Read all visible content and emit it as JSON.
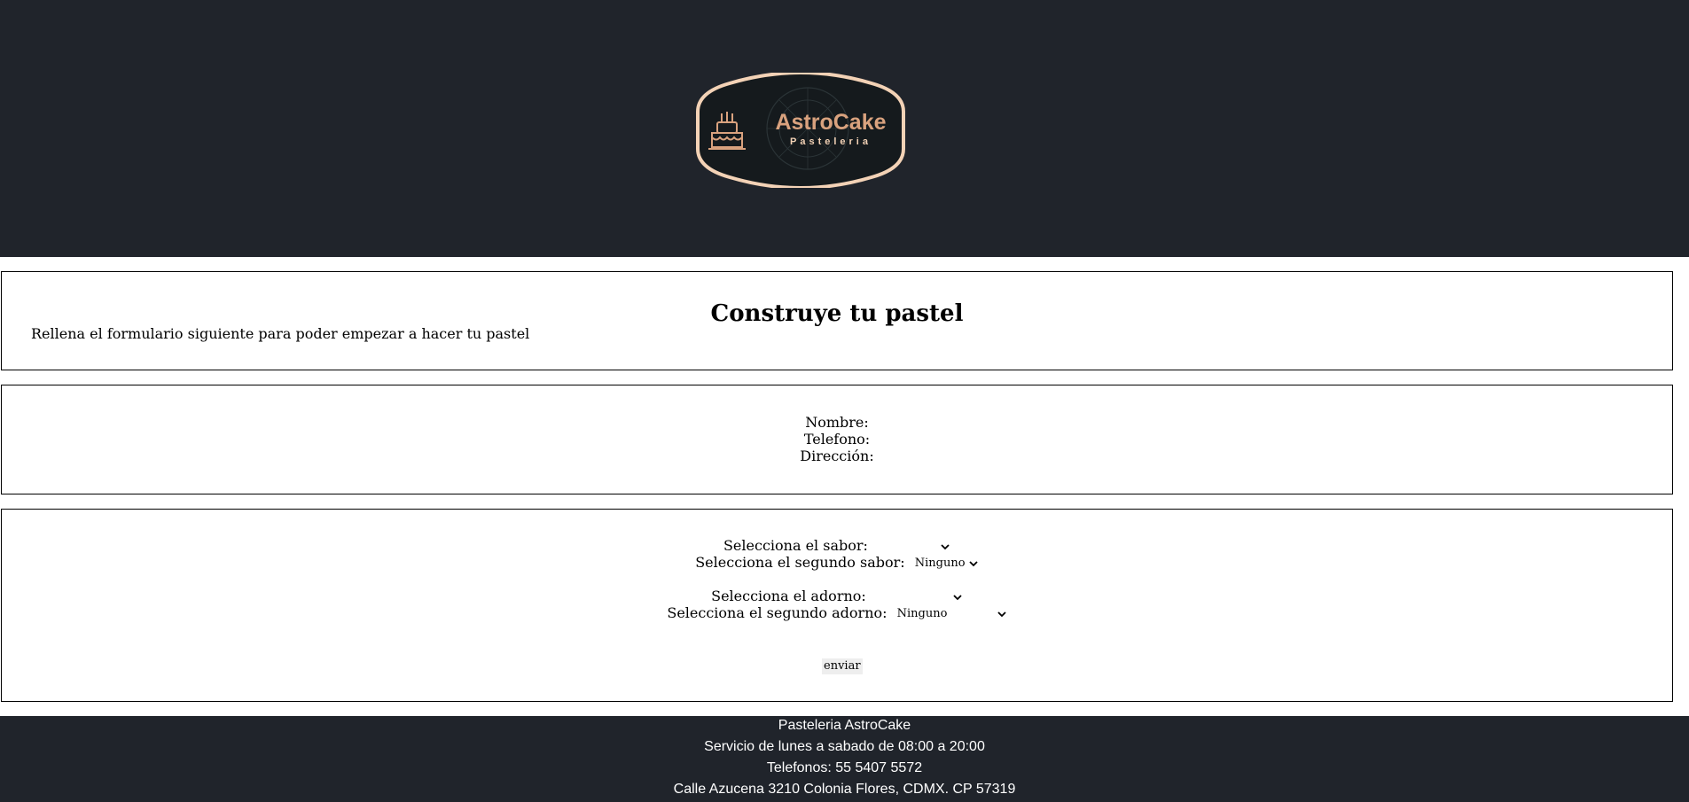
{
  "header": {
    "logo": {
      "name": "AstroCake",
      "tagline": "Pasteleria",
      "icon": "cake-icon",
      "colors": {
        "accent": "#d9a27e",
        "border": "#f3d2b6",
        "badge_bg": "#151a1d"
      }
    },
    "background": "#20242b"
  },
  "intro": {
    "title": "Construye tu pastel",
    "description": "Rellena el formulario siguiente para poder empezar a hacer tu pastel"
  },
  "contact_form": {
    "nombre_label": "Nombre:",
    "telefono_label": "Telefono:",
    "direccion_label": "Dirección:"
  },
  "options_form": {
    "sabor_label": "Selecciona el sabor:",
    "sabor_value": "",
    "segundo_sabor_label": "Selecciona el segundo sabor:",
    "segundo_sabor_value": "Ninguno",
    "adorno_label": "Selecciona el adorno:",
    "adorno_value": "",
    "segundo_adorno_label": "Selecciona el segundo adorno:",
    "segundo_adorno_value": "Ninguno",
    "submit_label": "enviar"
  },
  "footer": {
    "business_name": "Pasteleria AstroCake",
    "hours": "Servicio de lunes a sabado de 08:00 a 20:00",
    "phones": "Telefonos: 55 5407 5572",
    "address": "Calle Azucena 3210 Colonia Flores, CDMX. CP 57319",
    "background": "#20242b"
  }
}
